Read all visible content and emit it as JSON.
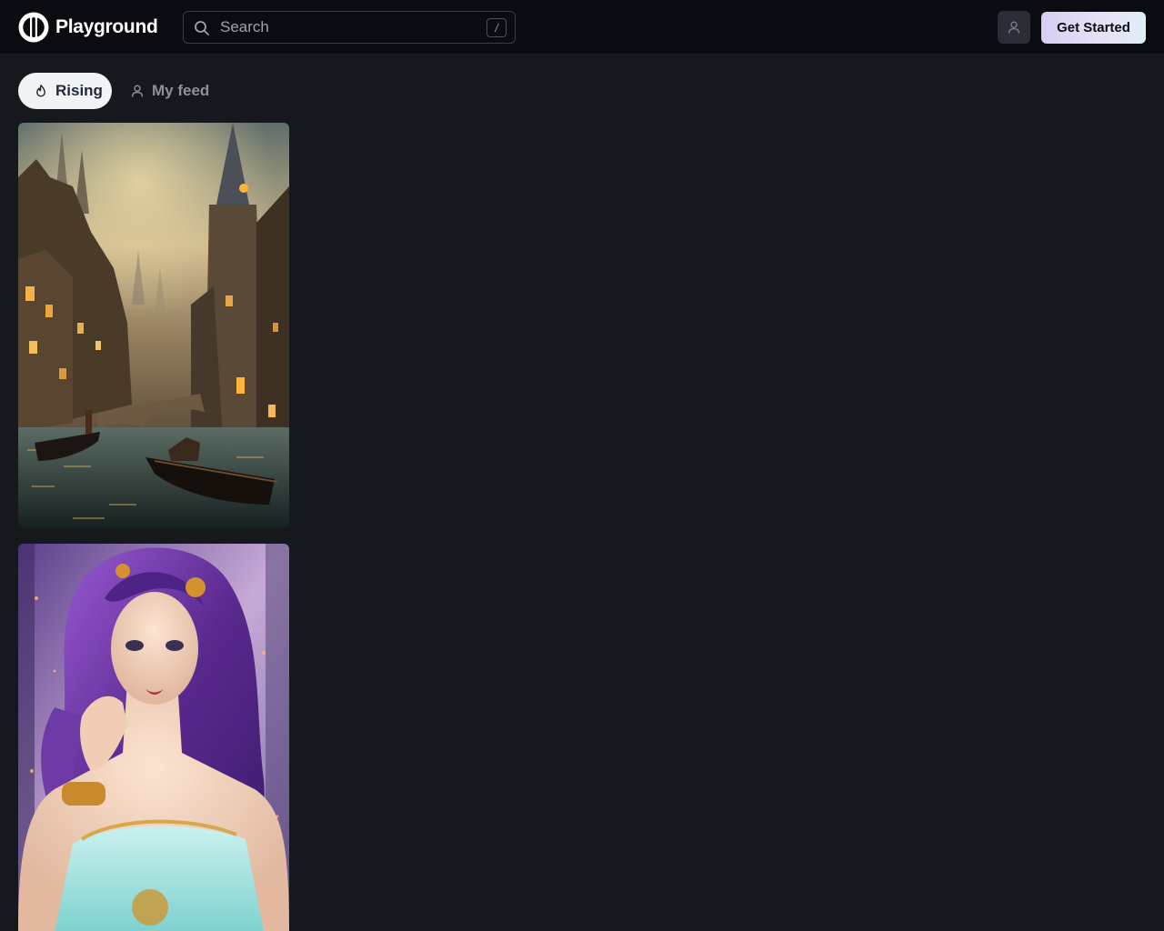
{
  "header": {
    "brand": "Playground",
    "search": {
      "placeholder": "Search",
      "value": "",
      "shortcut": "/"
    },
    "cta_label": "Get Started"
  },
  "tabs": [
    {
      "label": "Rising",
      "icon": "flame-icon",
      "active": true
    },
    {
      "label": "My feed",
      "icon": "user-icon",
      "active": false
    }
  ],
  "gallery": [
    {
      "subject": "fantasy-canal-city-gondolas"
    },
    {
      "subject": "fantasy-woman-purple-hair-portrait"
    }
  ],
  "colors": {
    "background": "#15181d",
    "header": "#0a0c12",
    "cta_gradient_start": "#d9cdf3",
    "cta_gradient_end": "#dfeef6"
  }
}
